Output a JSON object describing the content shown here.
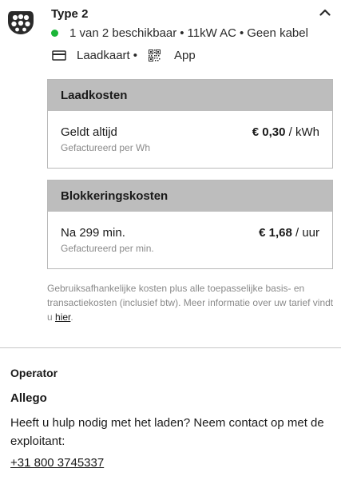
{
  "connector": {
    "type_title": "Type 2",
    "availability": "1 van 2 beschikbaar",
    "power": "11kW AC",
    "cable": "Geen kabel",
    "separator": "•",
    "status_color": "#1bb538",
    "payment_methods": {
      "card_label": "Laadkaart",
      "app_label": "App"
    }
  },
  "costs": {
    "charging": {
      "heading": "Laadkosten",
      "label": "Geldt altijd",
      "sub": "Gefactureerd per Wh",
      "price": "€ 0,30",
      "unit": "/ kWh"
    },
    "blocking": {
      "heading": "Blokkeringskosten",
      "label": "Na 299 min.",
      "sub": "Gefactureerd per min.",
      "price": "€ 1,68",
      "unit": "/ uur"
    },
    "disclaimer_text": "Gebruiksafhankelijke kosten plus alle toepasselijke basis- en transactiekosten (inclusief btw). Meer informatie over uw tarief vindt u ",
    "disclaimer_link": "hier",
    "disclaimer_end": "."
  },
  "operator": {
    "heading": "Operator",
    "name": "Allego",
    "help_text": "Heeft u hulp nodig met het laden? Neem contact op met de exploitant:",
    "phone": "+31 800 3745337"
  },
  "colors": {
    "header_gray": "#bdbdbd",
    "border_gray": "#b9b9b9",
    "muted_text": "#8a8a8a"
  },
  "icons": {
    "connector": "type2-plug-icon",
    "collapse": "chevron-up-icon",
    "card": "card-icon",
    "app": "qr-code-icon"
  }
}
